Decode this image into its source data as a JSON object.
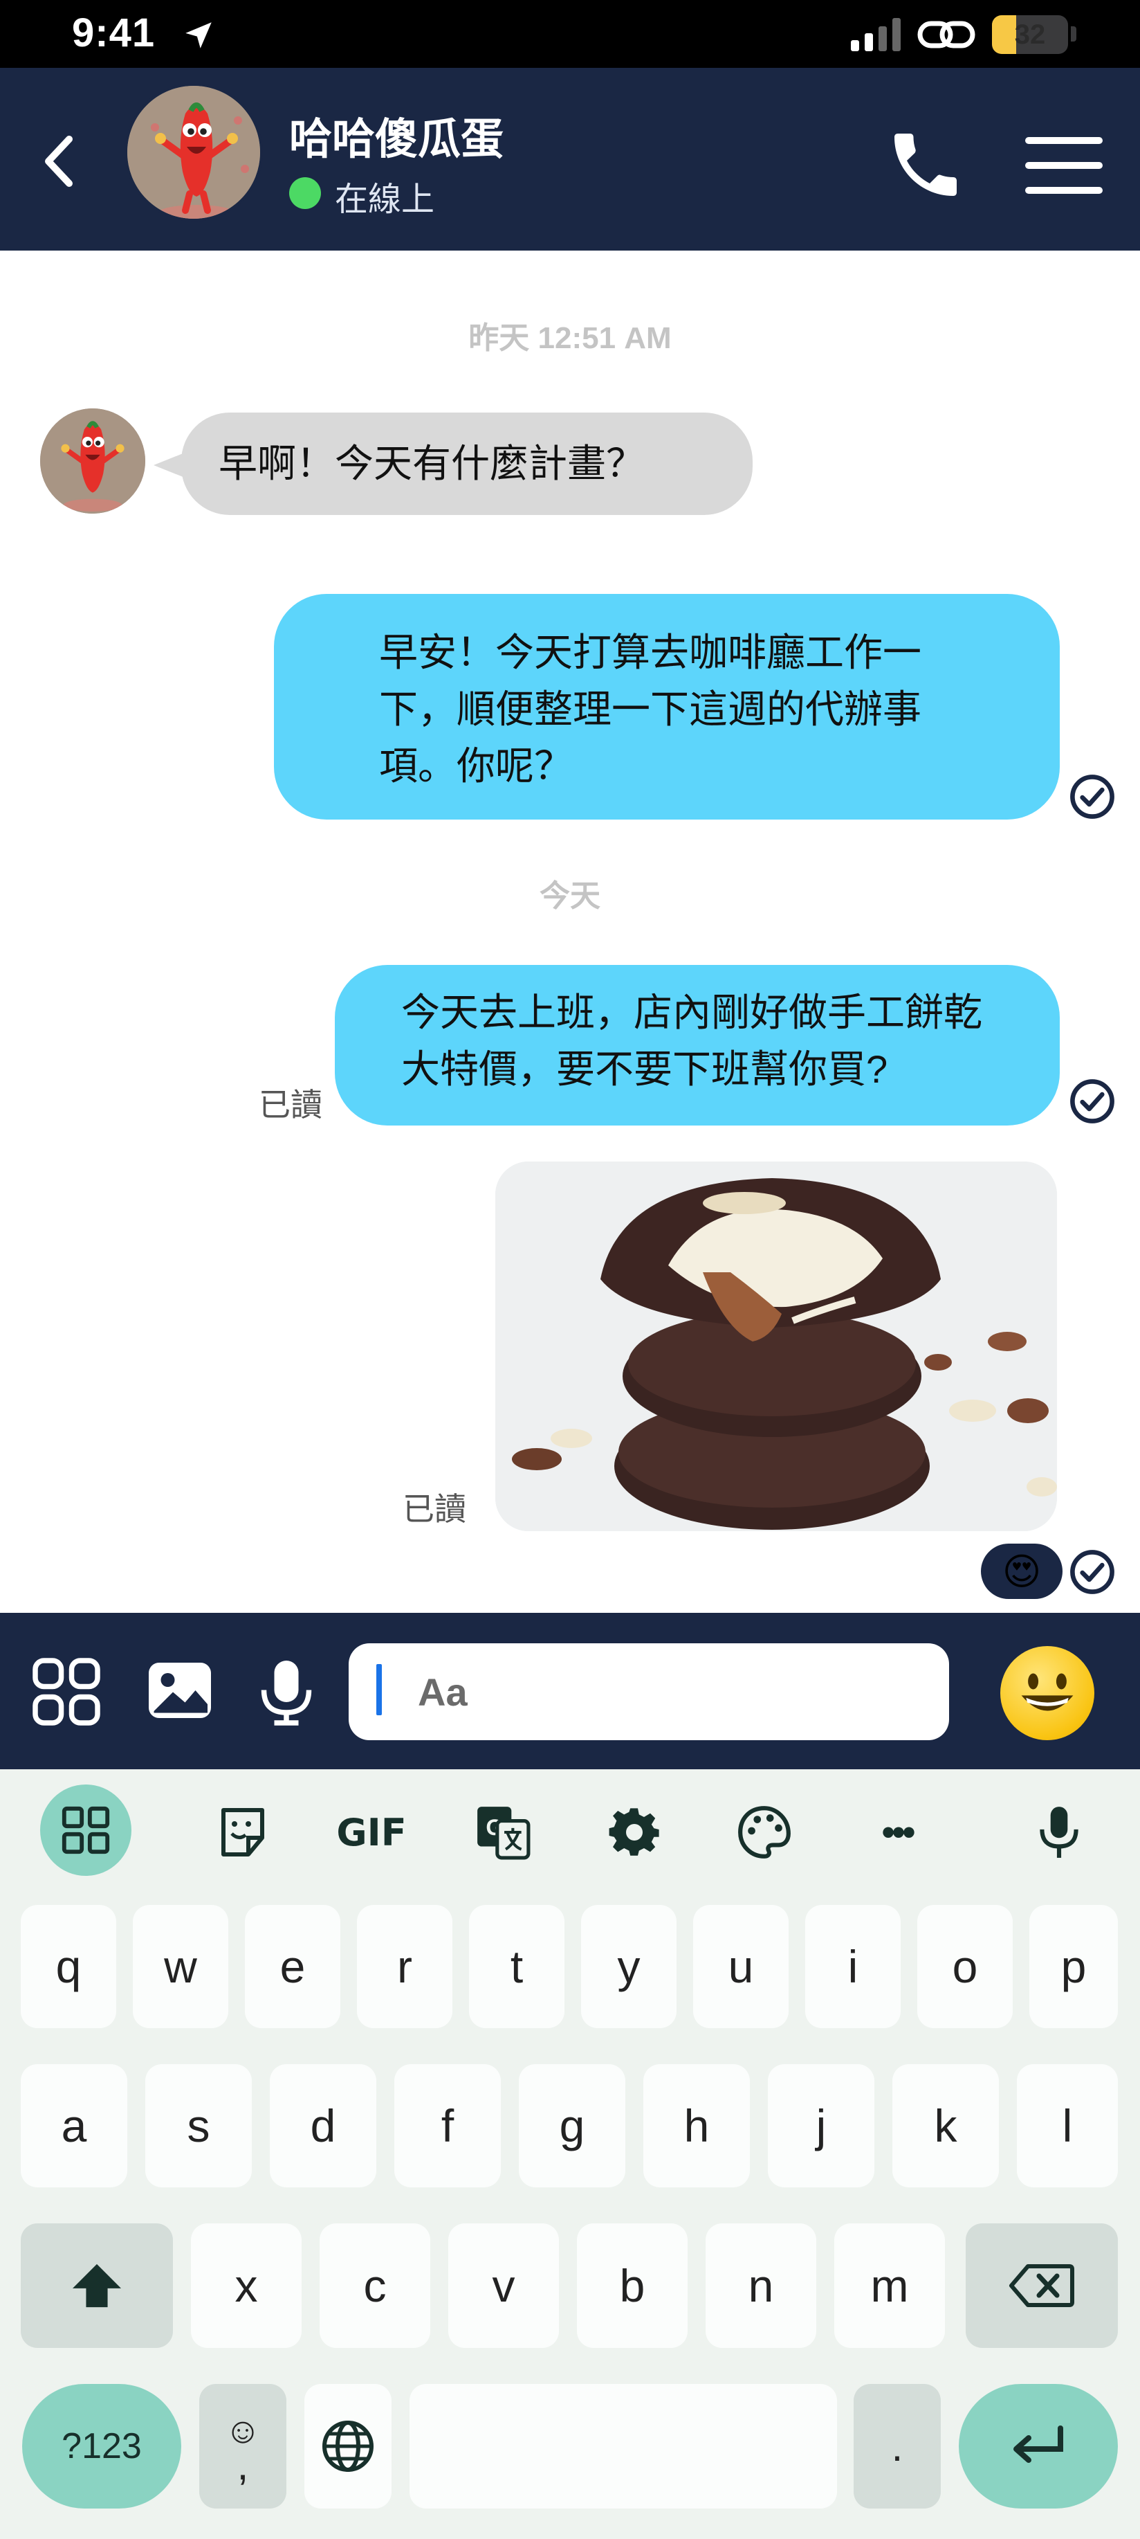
{
  "status_bar": {
    "time": "9:41",
    "battery_level": "32",
    "battery_fraction": 0.32
  },
  "header": {
    "contact_name": "哈哈傻瓜蛋",
    "status": "在線上",
    "status_color": "#4cd964",
    "background": "#1a2744"
  },
  "chat": {
    "separator_yesterday": "昨天 12:51 AM",
    "separator_today": "今天",
    "messages": [
      {
        "direction": "incoming",
        "text_lines": [
          "早啊！今天有什麼計畫？"
        ]
      },
      {
        "direction": "outgoing",
        "text_lines": [
          "早安！今天打算去咖啡廳工作一",
          "下，順便整理一下這週的代辦事",
          "項。你呢？"
        ]
      },
      {
        "direction": "outgoing",
        "text_lines": [
          "今天去上班，店內剛好做手工餅乾",
          "大特價，要不要下班幫你買?"
        ],
        "read_label": "已讀"
      },
      {
        "direction": "outgoing",
        "type": "image",
        "image_subject": "chocolate-cookies-photo",
        "read_label": "已讀",
        "reaction": "😍"
      }
    ],
    "outgoing_color": "#5dd5fb",
    "incoming_color": "#d9d9d9"
  },
  "composer": {
    "placeholder": "Aa",
    "emoji": "😀"
  },
  "keyboard": {
    "toolbar_items": [
      "apps-grid-icon",
      "sticker-icon",
      "GIF",
      "translate-icon",
      "settings-icon",
      "palette-icon",
      "more-icon",
      "mic-icon"
    ],
    "gif_label": "GIF",
    "more_label": "•••",
    "row1": [
      "q",
      "w",
      "e",
      "r",
      "t",
      "y",
      "u",
      "i",
      "o",
      "p"
    ],
    "row2": [
      "a",
      "s",
      "d",
      "f",
      "g",
      "h",
      "j",
      "k",
      "l"
    ],
    "row3": [
      "x",
      "c",
      "v",
      "b",
      "n",
      "m"
    ],
    "symbols_label": "?123",
    "emoji_comma_top": "☺",
    "emoji_comma_bottom": ",",
    "period_label": "."
  }
}
